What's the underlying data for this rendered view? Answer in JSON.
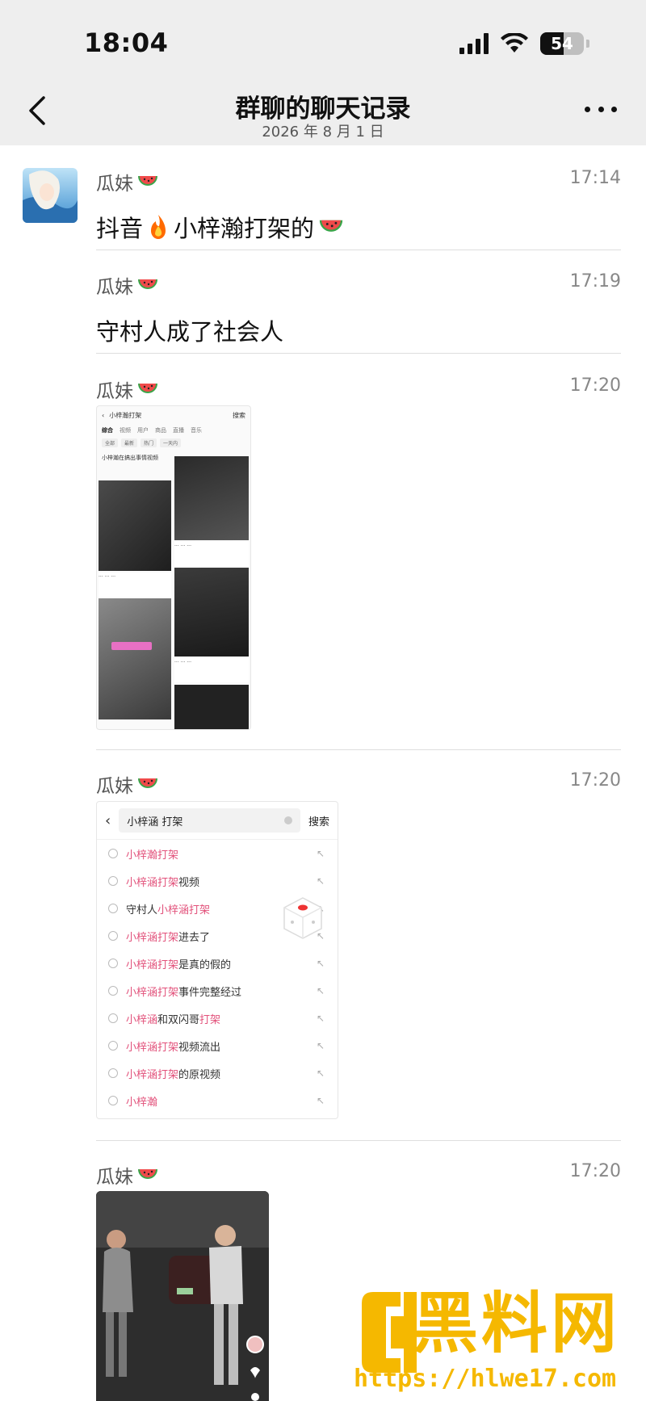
{
  "status_bar": {
    "time": "18:04",
    "battery": "54",
    "battery_level": 0.54
  },
  "header": {
    "back_icon": "chevron-left-icon",
    "title": "群聊的聊天记录",
    "date": "2026 年 8 月 1 日",
    "more_icon": "more-dots-icon"
  },
  "messages": [
    {
      "sender": "瓜妹",
      "time": "17:14",
      "text_before": "抖音",
      "text_after": "小梓瀚打架的"
    },
    {
      "sender": "瓜妹",
      "time": "17:19",
      "text": "守村人成了社会人"
    },
    {
      "sender": "瓜妹",
      "time": "17:20",
      "type": "image"
    },
    {
      "sender": "瓜妹",
      "time": "17:20",
      "type": "image"
    },
    {
      "sender": "瓜妹",
      "time": "17:20",
      "type": "image"
    }
  ],
  "screenshot_search": {
    "query": "小梓涵 打架",
    "button": "搜索",
    "suggestions": [
      {
        "hl": "小梓瀚打架",
        "rest": ""
      },
      {
        "hl": "小梓涵打架",
        "rest": "视频"
      },
      {
        "pre": "守村人",
        "hl": "小梓涵打架",
        "rest": ""
      },
      {
        "hl": "小梓涵打架",
        "rest": "进去了"
      },
      {
        "hl": "小梓涵打架",
        "rest": "是真的假的"
      },
      {
        "hl": "小梓涵打架",
        "rest": "事件完整经过"
      },
      {
        "hl": "小梓涵",
        "rest": "和双闪哥",
        "hl2": "打架"
      },
      {
        "hl": "小梓涵打架",
        "rest": "视频流出"
      },
      {
        "hl": "小梓涵打架",
        "rest": "的原视频"
      },
      {
        "hl": "小梓瀚",
        "rest": ""
      }
    ]
  },
  "screenshot_feed": {
    "query": "小梓瀚打架",
    "button": "搜索",
    "tabs": [
      "综合",
      "视频",
      "用户",
      "商品",
      "直播",
      "音乐"
    ],
    "heading": "小梓瀚在搞出事情视频"
  },
  "watermark": {
    "brand": "黑料网",
    "url": "https://hlwe17.com"
  },
  "colors": {
    "header_bg": "#eeeeee",
    "highlight": "#e2507a",
    "watermark": "#f5b800"
  }
}
